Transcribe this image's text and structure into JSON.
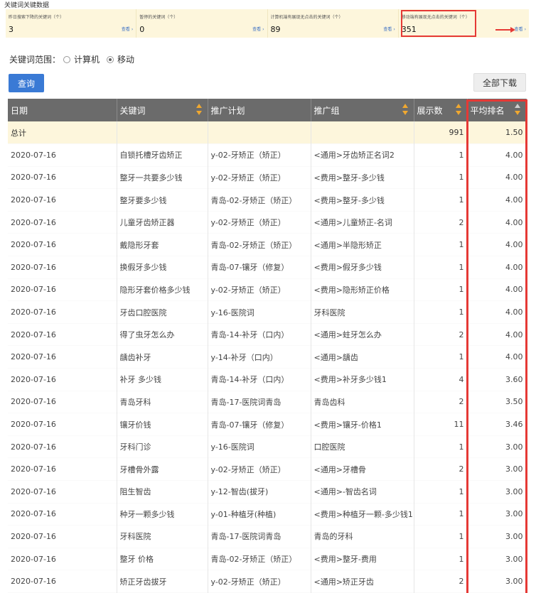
{
  "page_title": "关键词关键数据",
  "stats": [
    {
      "label": "昨日搜索下降的关键词（个）",
      "value": "3",
      "link": "查看"
    },
    {
      "label": "暂停的关键词（个）",
      "value": "0",
      "link": "查看"
    },
    {
      "label": "计算机端有展现无点击的关键词（个）",
      "value": "89",
      "link": "查看"
    },
    {
      "label": "移动端有展现无点击的关键词（个）",
      "value": "351",
      "link": "查看"
    }
  ],
  "scope": {
    "label": "关键词范围：",
    "option_pc": "计算机",
    "option_mobile": "移动"
  },
  "buttons": {
    "query": "查询",
    "download_all": "全部下载"
  },
  "table": {
    "headers": [
      "日期",
      "关键词",
      "推广计划",
      "推广组",
      "展示数",
      "平均排名"
    ],
    "total": {
      "label": "总计",
      "impressions": "991",
      "avg_rank": "1.50"
    },
    "rows": [
      {
        "date": "2020-07-16",
        "keyword": "自锁托槽牙齿矫正",
        "plan": "y-02-牙矫正（矫正）",
        "group": "<通用>牙齿矫正名词2",
        "impressions": "1",
        "avg_rank": "4.00"
      },
      {
        "date": "2020-07-16",
        "keyword": "整牙一共要多少钱",
        "plan": "y-02-牙矫正（矫正）",
        "group": "<费用>整牙-多少钱",
        "impressions": "1",
        "avg_rank": "4.00"
      },
      {
        "date": "2020-07-16",
        "keyword": "整牙要多少钱",
        "plan": "青岛-02-牙矫正（矫正）",
        "group": "<费用>整牙-多少钱",
        "impressions": "1",
        "avg_rank": "4.00"
      },
      {
        "date": "2020-07-16",
        "keyword": "儿童牙齿矫正器",
        "plan": "y-02-牙矫正（矫正）",
        "group": "<通用>儿童矫正-名词",
        "impressions": "2",
        "avg_rank": "4.00"
      },
      {
        "date": "2020-07-16",
        "keyword": "戴隐形牙套",
        "plan": "青岛-02-牙矫正（矫正）",
        "group": "<通用>半隐形矫正",
        "impressions": "1",
        "avg_rank": "4.00"
      },
      {
        "date": "2020-07-16",
        "keyword": "换假牙多少钱",
        "plan": "青岛-07-镶牙（修复）",
        "group": "<费用>假牙多少钱",
        "impressions": "1",
        "avg_rank": "4.00"
      },
      {
        "date": "2020-07-16",
        "keyword": "隐形牙套价格多少钱",
        "plan": "y-02-牙矫正（矫正）",
        "group": "<费用>隐形矫正价格",
        "impressions": "1",
        "avg_rank": "4.00"
      },
      {
        "date": "2020-07-16",
        "keyword": "牙齿口腔医院",
        "plan": "y-16-医院词",
        "group": "牙科医院",
        "impressions": "1",
        "avg_rank": "4.00"
      },
      {
        "date": "2020-07-16",
        "keyword": "得了虫牙怎么办",
        "plan": "青岛-14-补牙（口内）",
        "group": "<通用>蛀牙怎么办",
        "impressions": "2",
        "avg_rank": "4.00"
      },
      {
        "date": "2020-07-16",
        "keyword": "龋齿补牙",
        "plan": "y-14-补牙（口内）",
        "group": "<通用>龋齿",
        "impressions": "1",
        "avg_rank": "4.00"
      },
      {
        "date": "2020-07-16",
        "keyword": "补牙 多少钱",
        "plan": "青岛-14-补牙（口内）",
        "group": "<费用>补牙多少钱1",
        "impressions": "4",
        "avg_rank": "3.60"
      },
      {
        "date": "2020-07-16",
        "keyword": "青岛牙科",
        "plan": "青岛-17-医院词青岛",
        "group": "青岛齿科",
        "impressions": "2",
        "avg_rank": "3.50"
      },
      {
        "date": "2020-07-16",
        "keyword": "镶牙价钱",
        "plan": "青岛-07-镶牙（修复）",
        "group": "<费用>镶牙-价格1",
        "impressions": "11",
        "avg_rank": "3.46"
      },
      {
        "date": "2020-07-16",
        "keyword": "牙科门诊",
        "plan": "y-16-医院词",
        "group": "口腔医院",
        "impressions": "1",
        "avg_rank": "3.00"
      },
      {
        "date": "2020-07-16",
        "keyword": "牙槽骨外露",
        "plan": "y-02-牙矫正（矫正）",
        "group": "<通用>牙槽骨",
        "impressions": "2",
        "avg_rank": "3.00"
      },
      {
        "date": "2020-07-16",
        "keyword": "阻生智齿",
        "plan": "y-12-智齿(拔牙)",
        "group": "<通用>-智齿名词",
        "impressions": "1",
        "avg_rank": "3.00"
      },
      {
        "date": "2020-07-16",
        "keyword": "种牙一颗多少钱",
        "plan": "y-01-种植牙(种植)",
        "group": "<费用>种植牙一颗-多少钱1",
        "impressions": "1",
        "avg_rank": "3.00"
      },
      {
        "date": "2020-07-16",
        "keyword": "牙科医院",
        "plan": "青岛-17-医院词青岛",
        "group": "青岛的牙科",
        "impressions": "1",
        "avg_rank": "3.00"
      },
      {
        "date": "2020-07-16",
        "keyword": "整牙 价格",
        "plan": "青岛-02-牙矫正（矫正）",
        "group": "<费用>整牙-费用",
        "impressions": "1",
        "avg_rank": "3.00"
      },
      {
        "date": "2020-07-16",
        "keyword": "矫正牙齿拔牙",
        "plan": "y-02-牙矫正（矫正）",
        "group": "<通用>矫正牙齿",
        "impressions": "2",
        "avg_rank": "3.00"
      }
    ]
  },
  "colors": {
    "accent": "#3a7ad5",
    "header_bg": "#6b6b6b",
    "highlight": "#e53935",
    "sort_arrow": "#f0a830",
    "summary_bg": "#fdf6dc"
  }
}
